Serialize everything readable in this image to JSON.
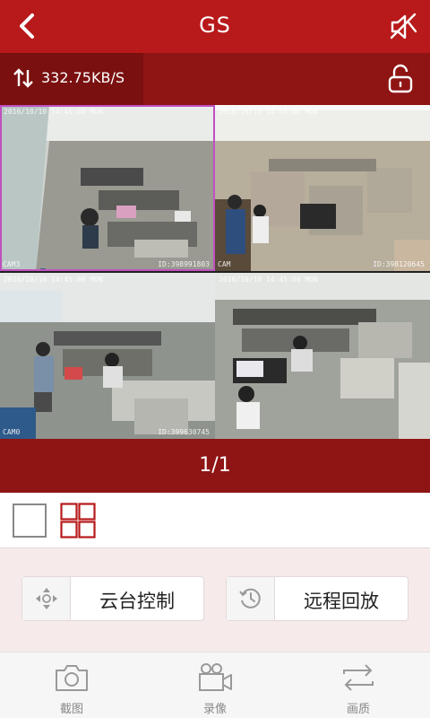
{
  "header": {
    "title": "GS",
    "back_icon": "chevron-left-icon",
    "mute_icon": "speaker-muted-icon"
  },
  "status": {
    "speed": "332.75KB/S",
    "speed_icon": "up-down-arrows-icon",
    "lock_icon": "unlocked-padlock-icon"
  },
  "cameras": [
    {
      "timestamp": "2016/10/10 14:45:00 MON",
      "name": "CAM3",
      "id": "ID:398991803",
      "active": true
    },
    {
      "timestamp": "2016/10/10 14:45:00 MON",
      "name": "CAM",
      "id": "ID:398120645",
      "active": false
    },
    {
      "timestamp": "2016/10/10 14:45:00 MON",
      "name": "CAM0",
      "id": "ID:399630745",
      "active": false
    },
    {
      "timestamp": "2016/10/10 14:45:00 MON",
      "name": "",
      "id": "",
      "active": false
    }
  ],
  "pagination": {
    "label": "1/1"
  },
  "layout": {
    "options": [
      "single-view",
      "quad-view"
    ],
    "selected": "quad-view"
  },
  "controls": {
    "ptz": {
      "label": "云台控制",
      "icon": "ptz-direction-icon"
    },
    "playback": {
      "label": "远程回放",
      "icon": "history-clock-icon"
    }
  },
  "nav": {
    "items": [
      {
        "label": "截图",
        "icon": "camera-icon"
      },
      {
        "label": "录像",
        "icon": "video-camera-icon"
      },
      {
        "label": "画质",
        "icon": "swap-arrows-icon"
      }
    ]
  },
  "colors": {
    "brand_red": "#b8191a",
    "dark_red": "#8f1414",
    "active_outline": "#c050c0"
  }
}
